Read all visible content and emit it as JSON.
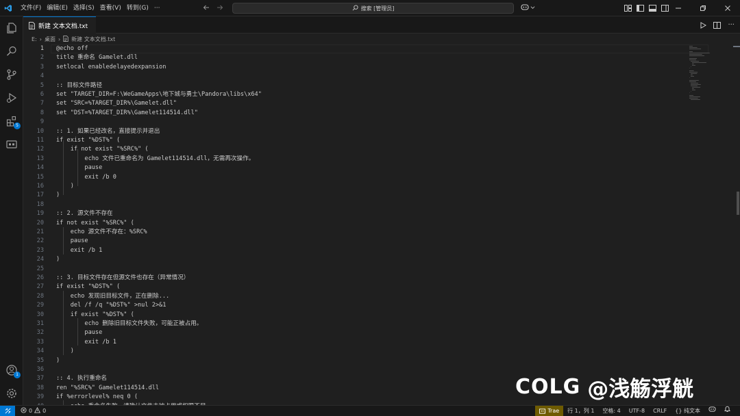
{
  "titlebar": {
    "menu": [
      "文件(F)",
      "编辑(E)",
      "选择(S)",
      "查看(V)",
      "转到(G)",
      "···"
    ],
    "search_text": "搜索 [管理员]"
  },
  "tabs": [
    {
      "label": "新建 文本文档.txt"
    }
  ],
  "breadcrumb": {
    "drive": "E:",
    "folder": "桌面",
    "file": "新建 文本文档.txt"
  },
  "activity_badges": {
    "extensions": "5",
    "accounts": "1"
  },
  "editor": {
    "active_line": 1,
    "lines": [
      "@echo off",
      "title 重命名 Gamelet.dll",
      "setlocal enabledelayedexpansion",
      "",
      ":: 目标文件路径",
      "set \"TARGET_DIR=F:\\WeGameApps\\地下城与勇士\\Pandora\\libs\\x64\"",
      "set \"SRC=%TARGET_DIR%\\Gamelet.dll\"",
      "set \"DST=%TARGET_DIR%\\Gamelet114514.dll\"",
      "",
      ":: 1. 如果已经改名，直接提示并退出",
      "if exist \"%DST%\" (",
      "    if not exist \"%SRC%\" (",
      "        echo 文件已重命名为 Gamelet114514.dll，无需再次操作。",
      "        pause",
      "        exit /b 0",
      "    )",
      ")",
      "",
      ":: 2. 源文件不存在",
      "if not exist \"%SRC%\" (",
      "    echo 源文件不存在：%SRC%",
      "    pause",
      "    exit /b 1",
      ")",
      "",
      ":: 3. 目标文件存在但源文件也存在（异常情况）",
      "if exist \"%DST%\" (",
      "    echo 发现旧目标文件，正在删除...",
      "    del /f /q \"%DST%\" >nul 2>&1",
      "    if exist \"%DST%\" (",
      "        echo 删除旧目标文件失败，可能正被占用。",
      "        pause",
      "        exit /b 1",
      "    )",
      ")",
      "",
      ":: 4. 执行重命名",
      "ren \"%SRC%\" Gamelet114514.dll",
      "if %errorlevel% neq 0 (",
      "    echo 重命名失败，请确认文件未被占用或权限不足"
    ]
  },
  "watermark": {
    "logo": "COLG",
    "text": "@浅觞浮觥"
  },
  "statusbar": {
    "errors": "0",
    "warnings": "0",
    "trae": "Trae",
    "position": "行 1，列 1",
    "spaces": "空格: 4",
    "encoding": "UTF-8",
    "eol": "CRLF",
    "language": "{} 纯文本"
  },
  "colors": {
    "accent": "#0078d4",
    "background": "#1f1f1f",
    "chrome": "#181818",
    "trae_bg": "#6e5b00"
  }
}
